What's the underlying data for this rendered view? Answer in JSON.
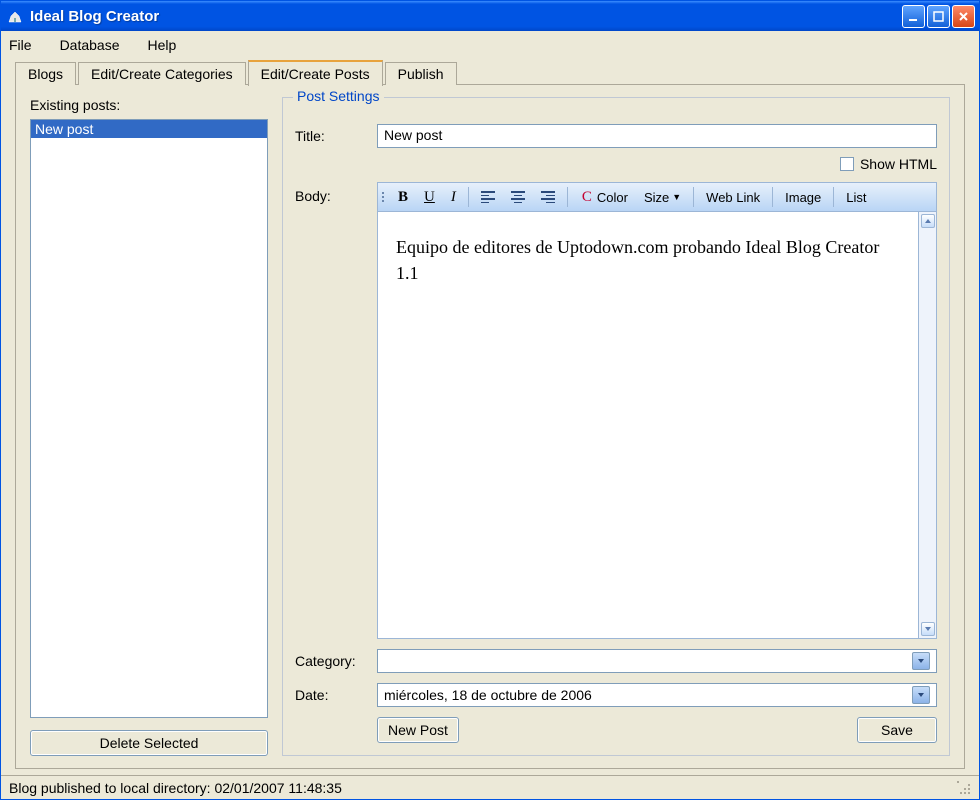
{
  "window": {
    "title": "Ideal Blog Creator"
  },
  "menu": {
    "file": "File",
    "database": "Database",
    "help": "Help"
  },
  "tabs": {
    "blogs": "Blogs",
    "categories": "Edit/Create Categories",
    "posts": "Edit/Create Posts",
    "publish": "Publish"
  },
  "left": {
    "label": "Existing posts:",
    "items": [
      "New post"
    ],
    "delete": "Delete Selected"
  },
  "fieldset": {
    "legend": "Post Settings"
  },
  "form": {
    "title_label": "Title:",
    "title_value": "New post",
    "show_html": "Show HTML",
    "body_label": "Body:",
    "category_label": "Category:",
    "category_value": "",
    "date_label": "Date:",
    "date_value": "miércoles, 18 de   octubre   de 2006",
    "new_post": "New Post",
    "save": "Save"
  },
  "toolbar": {
    "bold": "B",
    "underline": "U",
    "italic": "I",
    "color": "Color",
    "size": "Size",
    "weblink": "Web Link",
    "image": "Image",
    "list": "List"
  },
  "editor": {
    "text": "Equipo de editores de Uptodown.com probando Ideal Blog Creator 1.1"
  },
  "status": {
    "text": "Blog published to local directory: 02/01/2007 11:48:35"
  }
}
